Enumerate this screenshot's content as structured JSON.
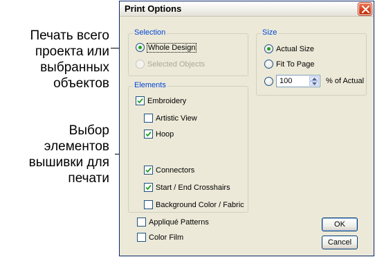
{
  "annotations": {
    "print_scope": [
      "Печать всего",
      "проекта или",
      "выбранных",
      "объектов"
    ],
    "select_elements": [
      "Выбор",
      "элементов",
      "вышивки для",
      "печати"
    ]
  },
  "dialog": {
    "title": "Print Options",
    "close_icon": "close-x-icon",
    "selection": {
      "legend": "Selection",
      "whole_design": "Whole Design",
      "selected_objects": "Selected Objects"
    },
    "size": {
      "legend": "Size",
      "actual_size": "Actual Size",
      "fit_to_page": "Fit To Page",
      "percent_value": "100",
      "percent_label": "% of Actual"
    },
    "elements": {
      "legend": "Elements",
      "embroidery": "Embroidery",
      "artistic_view": "Artistic View",
      "hoop": "Hoop",
      "connectors": "Connectors",
      "crosshairs": "Start / End Crosshairs",
      "background": "Background Color / Fabric"
    },
    "applique_patterns": "Appliqué Patterns",
    "color_film": "Color Film",
    "ok_label": "OK",
    "cancel_label": "Cancel",
    "colors": {
      "group_label": "#0046d5",
      "radio_dot": "#21a121",
      "close_button": "#d8421c",
      "dialog_face": "#ece9d8"
    }
  }
}
